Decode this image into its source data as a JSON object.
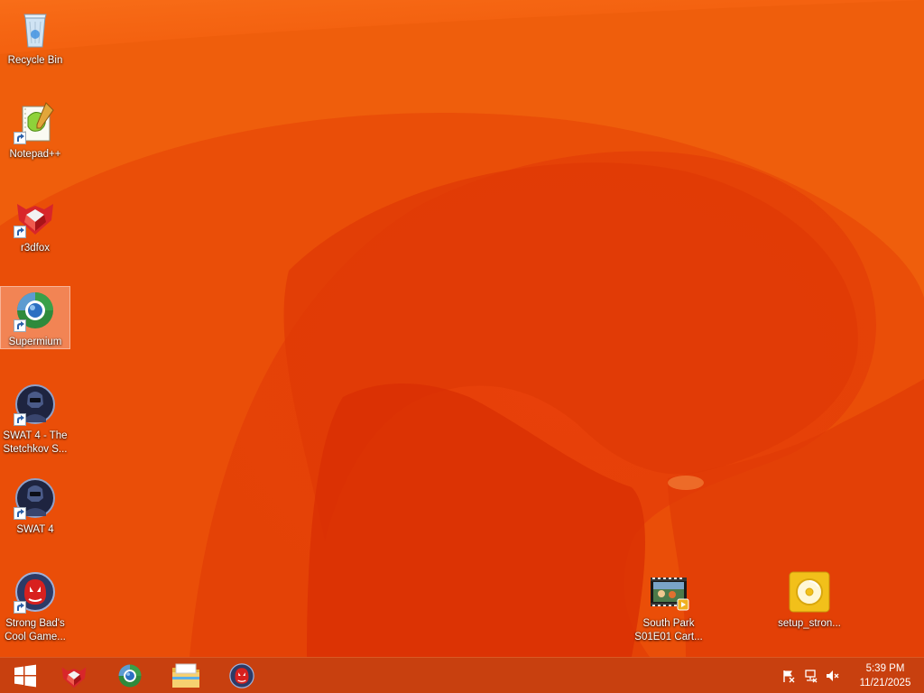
{
  "desktop": {
    "icons": [
      {
        "label": "Recycle Bin",
        "icon": "recycle-bin-icon",
        "shortcut": false
      },
      {
        "label": "Notepad++",
        "icon": "notepad-plus-plus-icon",
        "shortcut": true
      },
      {
        "label": "r3dfox",
        "icon": "r3dfox-icon",
        "shortcut": true
      },
      {
        "label": "Supermium",
        "icon": "supermium-icon",
        "shortcut": true,
        "selected": true
      },
      {
        "label": "SWAT 4 - The Stetchkov S...",
        "icon": "swat4-stetchkov-icon",
        "shortcut": true
      },
      {
        "label": "SWAT 4",
        "icon": "swat4-icon",
        "shortcut": true
      },
      {
        "label": "Strong Bad's Cool Game...",
        "icon": "strong-bad-game-icon",
        "shortcut": true
      },
      {
        "label": "South Park S01E01 Cart...",
        "icon": "video-file-icon",
        "shortcut": false
      },
      {
        "label": "setup_stron...",
        "icon": "disc-installer-icon",
        "shortcut": false
      }
    ]
  },
  "taskbar": {
    "start": {
      "icon": "windows-start-icon"
    },
    "pinned": [
      {
        "icon": "r3dfox-icon"
      },
      {
        "icon": "supermium-icon"
      },
      {
        "icon": "file-explorer-icon"
      },
      {
        "icon": "strong-bad-game-icon"
      }
    ],
    "tray": {
      "icons": [
        "action-center-flag-icon",
        "network-icon",
        "volume-muted-icon"
      ],
      "time": "5:39 PM",
      "date": "11/21/2025"
    }
  },
  "colors": {
    "wallpaper": "#ea4a06",
    "taskbar": "#c8400f",
    "label_text": "#ffffff"
  }
}
